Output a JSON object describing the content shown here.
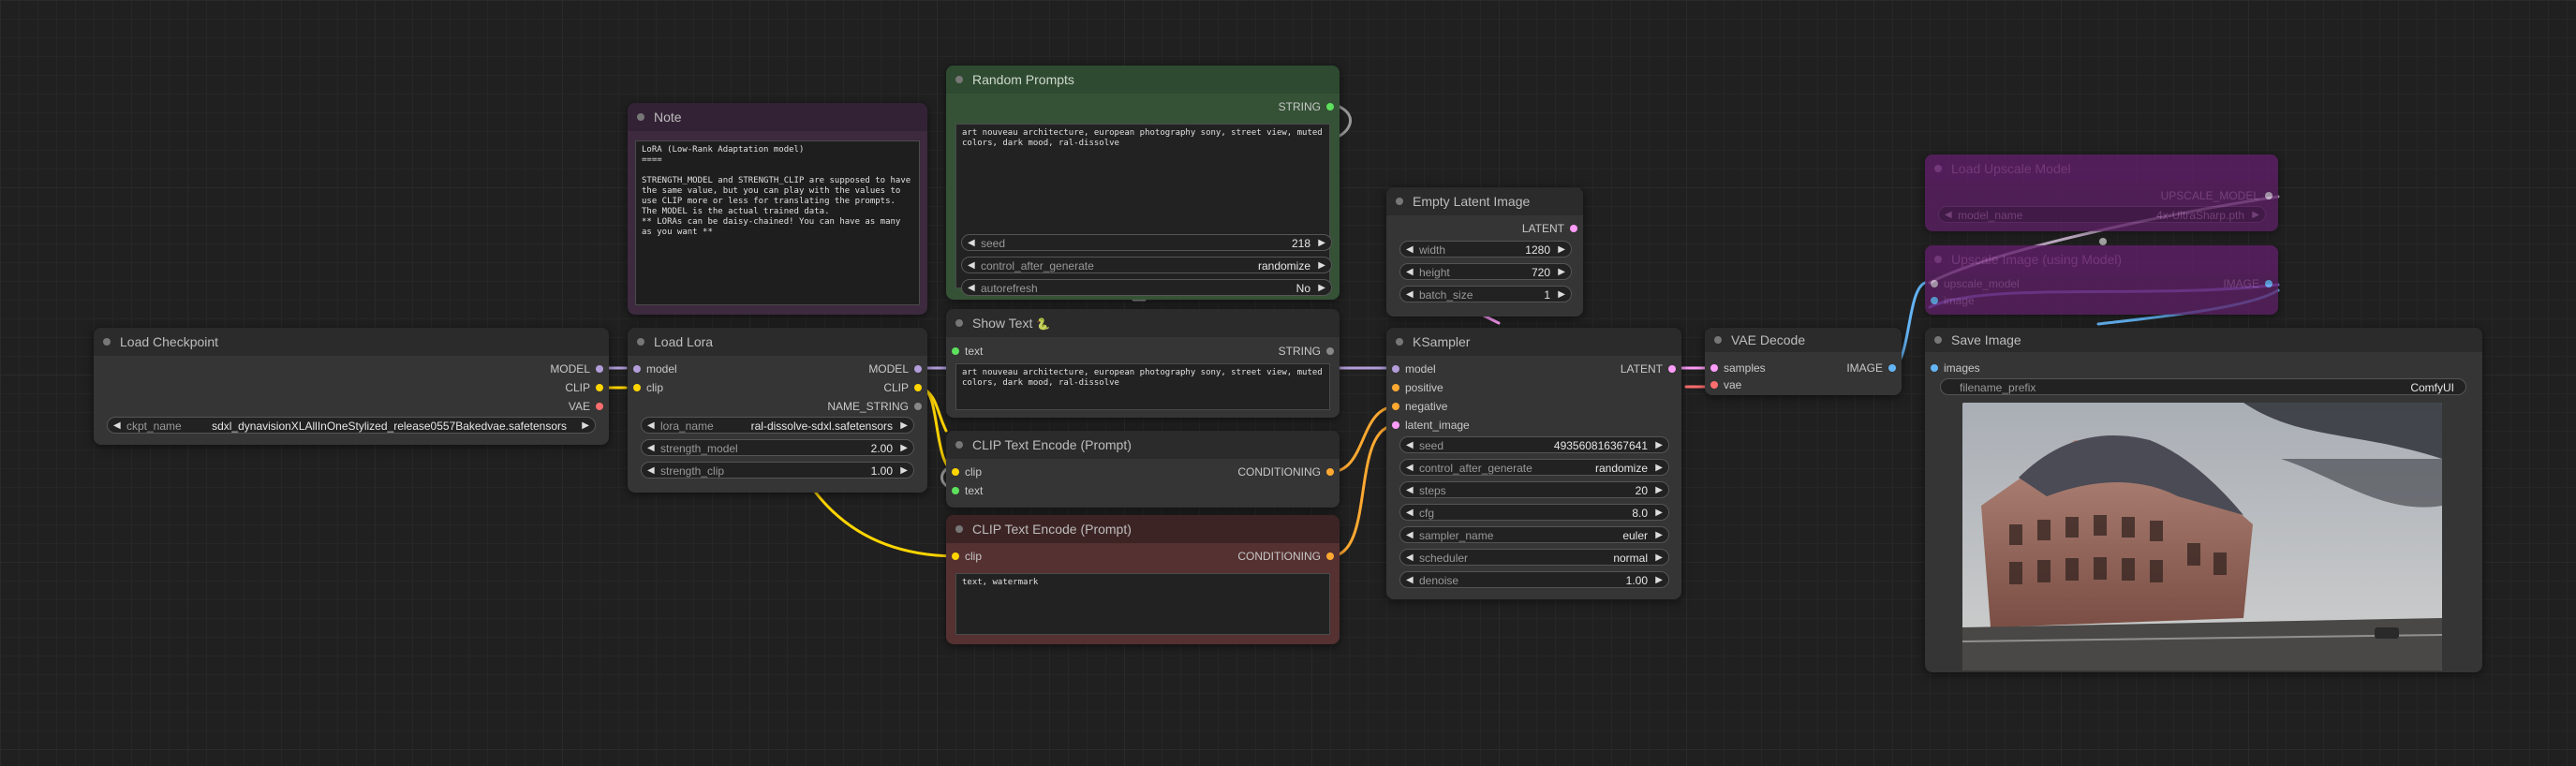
{
  "colors": {
    "model": "#b39ddb",
    "clip": "#ffd500",
    "vae": "#ff6e6e",
    "latent": "#ff9cf9",
    "conditioning": "#ffa931",
    "string": "#5de05d",
    "image": "#64b5f6",
    "upscale": "#c5b0c9"
  },
  "load_checkpoint": {
    "title": "Load Checkpoint",
    "outputs": [
      "MODEL",
      "CLIP",
      "VAE"
    ],
    "ckpt_name_label": "ckpt_name",
    "ckpt_name": "sdxl_dynavisionXLAllInOneStylized_release0557Bakedvae.safetensors"
  },
  "note": {
    "title": "Note",
    "text": "LoRA (Low-Rank Adaptation model)\n====\n\nSTRENGTH_MODEL and STRENGTH_CLIP are supposed to have\nthe same value, but you can play with the values to\nuse CLIP more or less for translating the prompts.\nThe MODEL is the actual trained data.\n** LORAs can be daisy-chained! You can have as many\nas you want **"
  },
  "load_lora": {
    "title": "Load Lora",
    "inputs": [
      "model",
      "clip"
    ],
    "outputs": [
      "MODEL",
      "CLIP",
      "NAME_STRING"
    ],
    "widgets": [
      {
        "name": "lora_name",
        "value": "ral-dissolve-sdxl.safetensors"
      },
      {
        "name": "strength_model",
        "value": "2.00"
      },
      {
        "name": "strength_clip",
        "value": "1.00"
      }
    ]
  },
  "random_prompts": {
    "title": "Random Prompts",
    "output": "STRING",
    "text": "art nouveau architecture, european photography sony, street view, muted\ncolors, dark mood, ral-dissolve",
    "widgets": [
      {
        "name": "seed",
        "value": "218"
      },
      {
        "name": "control_after_generate",
        "value": "randomize"
      },
      {
        "name": "autorefresh",
        "value": "No"
      }
    ]
  },
  "show_text": {
    "title": "Show Text",
    "title_icon": "🐍",
    "input": "text",
    "output": "STRING",
    "text": "art nouveau architecture, european photography sony, street view, muted\ncolors, dark mood, ral-dissolve"
  },
  "clip_encode_pos": {
    "title": "CLIP Text Encode (Prompt)",
    "inputs": [
      "clip",
      "text"
    ],
    "output": "CONDITIONING"
  },
  "clip_encode_neg": {
    "title": "CLIP Text Encode (Prompt)",
    "input": "clip",
    "output": "CONDITIONING",
    "text": "text, watermark"
  },
  "empty_latent": {
    "title": "Empty Latent Image",
    "output": "LATENT",
    "widgets": [
      {
        "name": "width",
        "value": "1280"
      },
      {
        "name": "height",
        "value": "720"
      },
      {
        "name": "batch_size",
        "value": "1"
      }
    ]
  },
  "ksampler": {
    "title": "KSampler",
    "inputs": [
      "model",
      "positive",
      "negative",
      "latent_image"
    ],
    "output": "LATENT",
    "widgets": [
      {
        "name": "seed",
        "value": "493560816367641"
      },
      {
        "name": "control_after_generate",
        "value": "randomize"
      },
      {
        "name": "steps",
        "value": "20"
      },
      {
        "name": "cfg",
        "value": "8.0"
      },
      {
        "name": "sampler_name",
        "value": "euler"
      },
      {
        "name": "scheduler",
        "value": "normal"
      },
      {
        "name": "denoise",
        "value": "1.00"
      }
    ]
  },
  "vae_decode": {
    "title": "VAE Decode",
    "inputs": [
      "samples",
      "vae"
    ],
    "output": "IMAGE"
  },
  "load_upscale": {
    "title": "Load Upscale Model",
    "output": "UPSCALE_MODEL",
    "widget": {
      "name": "model_name",
      "value": "4x-UltraSharp.pth"
    }
  },
  "upscale_image": {
    "title": "Upscale Image (using Model)",
    "inputs": [
      "upscale_model",
      "image"
    ],
    "output": "IMAGE"
  },
  "save_image": {
    "title": "Save Image",
    "input": "images",
    "widget": {
      "name": "filename_prefix",
      "value": "ComfyUI"
    }
  }
}
